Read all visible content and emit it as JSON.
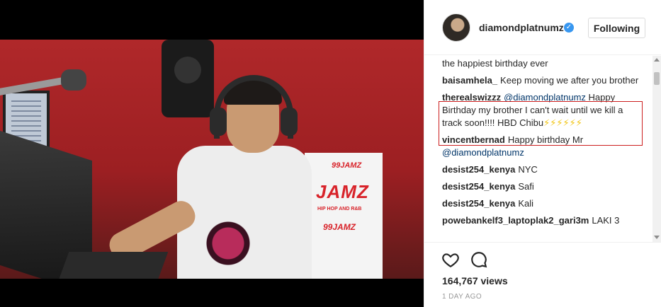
{
  "post": {
    "username": "diamondplatnumz",
    "follow_label": "Following",
    "views": "164,767 views",
    "timestamp": "1 DAY AGO"
  },
  "video_scene": {
    "banner_logo": "JAMZ",
    "banner_small": "99JAMZ",
    "banner_sub": "HIP HOP AND R&B",
    "banner_logo2": "99JAMZ"
  },
  "comments": [
    {
      "user": "",
      "text": "the happiest birthday ever"
    },
    {
      "user": "baisamhela_",
      "text": "Keep moving we after you brother"
    },
    {
      "user": "therealswizzz",
      "mention": "@diamondplatnumz",
      "text": "Happy Birthday my brother I can't wait until we kill a track soon!!!! HBD Chibu",
      "emoji": "⚡⚡⚡⚡⚡⚡"
    },
    {
      "user": "vincentbernad",
      "text": "Happy birthday Mr",
      "mention": "@diamondplatnumz"
    },
    {
      "user": "desist254_kenya",
      "text": "NYC"
    },
    {
      "user": "desist254_kenya",
      "text": "Safi"
    },
    {
      "user": "desist254_kenya",
      "text": "Kali"
    },
    {
      "user": "powebankelf3_laptoplak2_gari3m",
      "text": "LAKI 3"
    }
  ],
  "colors": {
    "verified": "#3897f0",
    "mention": "#003569",
    "highlight": "#cc1f1f"
  },
  "icons": [
    "heart-icon",
    "comment-icon",
    "verified-badge-icon"
  ]
}
